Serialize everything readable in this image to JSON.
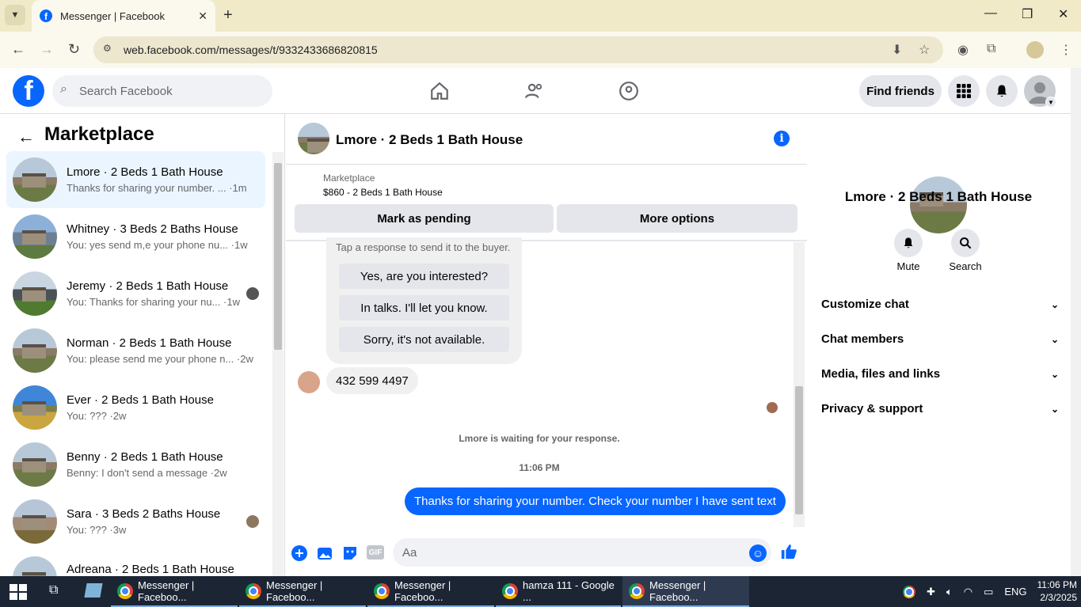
{
  "browser": {
    "tab_title": "Messenger | Facebook",
    "url": "web.facebook.com/messages/t/9332433686820815"
  },
  "fb": {
    "logo_letter": "f",
    "search_placeholder": "Search Facebook",
    "find_friends": "Find friends"
  },
  "left": {
    "title": "Marketplace",
    "conversations": [
      {
        "name": "Lmore · 2 Beds 1 Bath House",
        "preview": "Thanks for sharing your number. ... ·1m"
      },
      {
        "name": "Whitney · 3 Beds 2 Baths House",
        "preview": "You: yes send m,e your phone nu... ·1w"
      },
      {
        "name": "Jeremy · 2 Beds 1 Bath House",
        "preview": "You: Thanks for sharing your nu... ·1w"
      },
      {
        "name": "Norman · 2 Beds 1 Bath House",
        "preview": "You: please send me your phone n... ·2w"
      },
      {
        "name": "Ever · 2 Beds 1 Bath House",
        "preview": "You: ??? ·2w"
      },
      {
        "name": "Benny · 2 Beds 1 Bath House",
        "preview": "Benny: I don't send a message ·2w"
      },
      {
        "name": "Sara · 3 Beds 2 Baths House",
        "preview": "You: ??? ·3w"
      },
      {
        "name": "Adreana · 2 Beds 1 Bath House",
        "preview": ""
      }
    ]
  },
  "chat": {
    "name": "Lmore · 2 Beds 1 Bath House",
    "marketplace_label": "Marketplace",
    "listing": "$860 - 2 Beds 1 Bath House",
    "mark_pending": "Mark as pending",
    "more_options": "More options",
    "quick_hint": "Tap a response to send it to the buyer.",
    "quick_replies": [
      "Yes, are you interested?",
      "In talks. I'll let you know.",
      "Sorry, it's not available."
    ],
    "received": "432 599 4497",
    "waiting": "Lmore is waiting for your response.",
    "time": "11:06 PM",
    "sent": "Thanks for sharing your number.  Check your number I have sent text",
    "compose_placeholder": "Aa",
    "gif": "GIF"
  },
  "right": {
    "name": "Lmore · 2 Beds 1 Bath House",
    "mute": "Mute",
    "search": "Search",
    "sections": [
      "Customize chat",
      "Chat members",
      "Media, files and links",
      "Privacy & support"
    ]
  },
  "taskbar": {
    "items": [
      "Messenger | Faceboo...",
      "Messenger | Faceboo...",
      "Messenger | Faceboo...",
      "hamza 111 - Google ...",
      "Messenger | Faceboo..."
    ],
    "lang": "ENG",
    "time": "11:06 PM",
    "date": "2/3/2025"
  },
  "colors": {
    "accent": "#0866ff",
    "chrome_tabbar": "#f0eac9",
    "taskbar": "#1c2534"
  }
}
